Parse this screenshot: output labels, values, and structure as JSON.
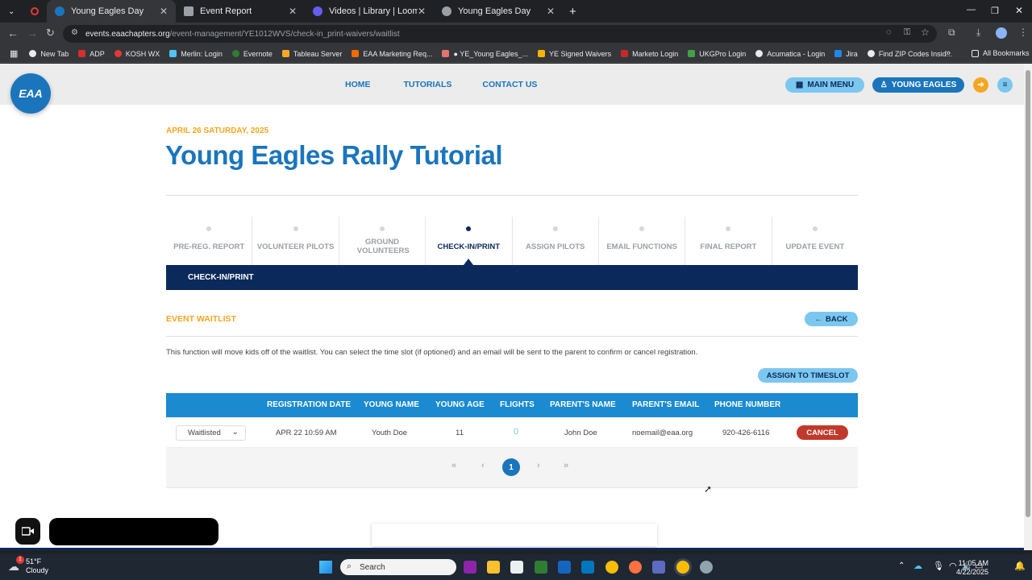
{
  "browser": {
    "tabs": [
      {
        "label": "Young Eagles Day",
        "active": true
      },
      {
        "label": "Event Report",
        "active": false
      },
      {
        "label": "Videos | Library | Loom",
        "active": false
      },
      {
        "label": "Young Eagles Day",
        "active": false
      }
    ],
    "url_host": "events.eaachapters.org",
    "url_path": "/event-management/YE1012WVS/check-in_print-waivers/waitlist",
    "bookmarks": [
      "New Tab",
      "ADP",
      "KOSH WX",
      "Merlin: Login",
      "Evernote",
      "Tableau Server",
      "EAA Marketing Req...",
      "● YE_Young Eagles_...",
      "YE Signed Waivers",
      "Marketo Login",
      "UKGPro Login",
      "Acumatica - Login",
      "Jira",
      "Find ZIP Codes Insid..."
    ],
    "all_bookmarks": "All Bookmarks"
  },
  "nav": {
    "logo_text": "EAA",
    "links": [
      "HOME",
      "TUTORIALS",
      "CONTACT US"
    ],
    "main_menu": "MAIN MENU",
    "young_eagles": "YOUNG EAGLES"
  },
  "event": {
    "date": "APRIL 26 SATURDAY, 2025",
    "title": "Young Eagles Rally Tutorial"
  },
  "steps": [
    {
      "label": "PRE-REG. REPORT",
      "active": false
    },
    {
      "label": "VOLUNTEER PILOTS",
      "active": false
    },
    {
      "label": "GROUND VOLUNTEERS",
      "active": false
    },
    {
      "label": "CHECK-IN/PRINT",
      "active": true
    },
    {
      "label": "ASSIGN PILOTS",
      "active": false
    },
    {
      "label": "EMAIL FUNCTIONS",
      "active": false
    },
    {
      "label": "FINAL REPORT",
      "active": false
    },
    {
      "label": "UPDATE EVENT",
      "active": false
    }
  ],
  "subbar_label": "CHECK-IN/PRINT",
  "section": {
    "title": "EVENT WAITLIST",
    "back": "BACK",
    "description": "This function will move kids off of the waitlist. You can select the time slot (if optioned) and an email will be sent to the parent to confirm or cancel registration.",
    "assign_button": "ASSIGN TO TIMESLOT"
  },
  "table": {
    "columns": [
      "REGISTRATION DATE",
      "YOUNG NAME",
      "YOUNG AGE",
      "FLIGHTS",
      "PARENT'S NAME",
      "PARENT'S EMAIL",
      "PHONE NUMBER"
    ],
    "rows": [
      {
        "status": "Waitlisted",
        "registration_date": "APR 22 10:59 AM",
        "young_name": "Youth Doe",
        "young_age": "11",
        "flights": "0",
        "parent_name": "John Doe",
        "parent_email": "noemail@eaa.org",
        "phone": "920-426-6116",
        "action": "CANCEL"
      }
    ]
  },
  "pagination": {
    "first": "«",
    "prev": "‹",
    "current": "1",
    "next": "›",
    "last": "»"
  },
  "taskbar": {
    "temp": "51°F",
    "weather": "Cloudy",
    "search": "Search",
    "time": "11:05 AM",
    "date": "4/22/2025",
    "notif_count": "1"
  },
  "colors": {
    "brand_blue": "#1b75bc",
    "navy": "#0b2a5b",
    "orange": "#f5a623",
    "cancel_red": "#c0392b"
  }
}
